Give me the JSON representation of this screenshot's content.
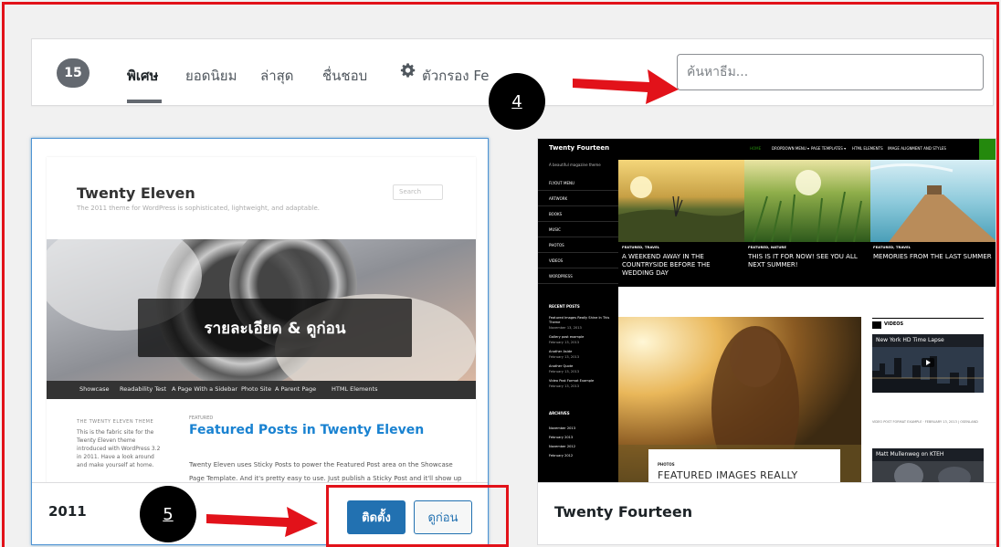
{
  "filter_bar": {
    "count": "15",
    "links": [
      "พิเศษ",
      "ยอดนิยม",
      "ล่าสุด",
      "ชื่นชอบ"
    ],
    "feature_filter_label": "ตัวกรอง Fe",
    "search_placeholder": "ค้นหาธีม...",
    "icon": "gear-icon"
  },
  "themes": [
    {
      "name": "2011",
      "install_label": "ติดตั้ง",
      "preview_label": "ดูก่อน",
      "details_overlay": "รายละเอียด & ดูก่อน",
      "screenshot": {
        "site_title": "Twenty Eleven",
        "tagline": "The 2011 theme for WordPress is sophisticated, lightweight, and adaptable.",
        "search": "Search",
        "nav": [
          "Showcase",
          "Readability Test",
          "A Page With a Sidebar",
          "Photo Site",
          "A Parent Page",
          "HTML Elements"
        ],
        "sidebar_heading": "THE TWENTY ELEVEN THEME",
        "sidebar_text": "This is the fabric site for the Twenty Eleven theme introduced with WordPress 3.2 in 2011. Have a look around and make yourself at home.",
        "featured_label": "FEATURED",
        "featured_title": "Featured Posts in Twenty Eleven",
        "body_text": "Twenty Eleven uses Sticky Posts to power the Featured Post area on the Showcase Page Template. And it's pretty easy to use. Just publish a Sticky Post and it'll show up"
      }
    },
    {
      "name": "Twenty Fourteen",
      "screenshot": {
        "site_title": "Twenty Fourteen",
        "tagline": "A beautiful magazine theme",
        "menu": [
          "HOME",
          "DROPDOWN MENU ▾",
          "PAGE TEMPLATES ▾",
          "HTML ELEMENTS",
          "IMAGE ALIGNMENT AND STYLES"
        ],
        "sidebar": [
          "FLYOUT MENU",
          "ARTWORK",
          "BOOKS",
          "MUSIC",
          "PHOTOS",
          "VIDEOS",
          "WORDPRESS"
        ],
        "recent_posts_heading": "RECENT POSTS",
        "recent_posts": [
          {
            "title": "Featured Images Really Shine In This Theme",
            "date": "November 13, 2013"
          },
          {
            "title": "Gallery post example",
            "date": "February 13, 2013"
          },
          {
            "title": "Another Aside",
            "date": "February 13, 2013"
          },
          {
            "title": "Another Quote",
            "date": "February 13, 2013"
          },
          {
            "title": "Video Post Format Example",
            "date": "February 13, 2013"
          }
        ],
        "archives_heading": "ARCHIVES",
        "archives": [
          "November 2013",
          "February 2013",
          "November 2012",
          "February 2012"
        ],
        "featured": [
          {
            "category": "FEATURED, TRAVEL",
            "title": "A WEEKEND AWAY IN THE COUNTRYSIDE BEFORE THE WEDDING DAY"
          },
          {
            "category": "FEATURED, NATURE",
            "title": "THIS IS IT FOR NOW! SEE YOU ALL NEXT SUMMER!"
          },
          {
            "category": "FEATURED, TRAVEL",
            "title": "MEMORIES FROM THE LAST SUMMER"
          }
        ],
        "post_category": "PHOTOS",
        "post_title": "FEATURED IMAGES REALLY",
        "videos_heading": "VIDEOS",
        "video1_title": "New York HD Time Lapse",
        "video_caption": "VIDEO POST FORMAT EXAMPLE · FEBRUARY 13, 2013 | OSENLAND",
        "video2_title": "Matt Mullenweg on KTEH"
      }
    }
  ],
  "annotations": {
    "step4": "4",
    "step5": "5",
    "color": "#e2121a"
  },
  "colors": {
    "accent": "#2271b1",
    "annotation": "#e2121a",
    "fourteen_green": "#24890d"
  }
}
